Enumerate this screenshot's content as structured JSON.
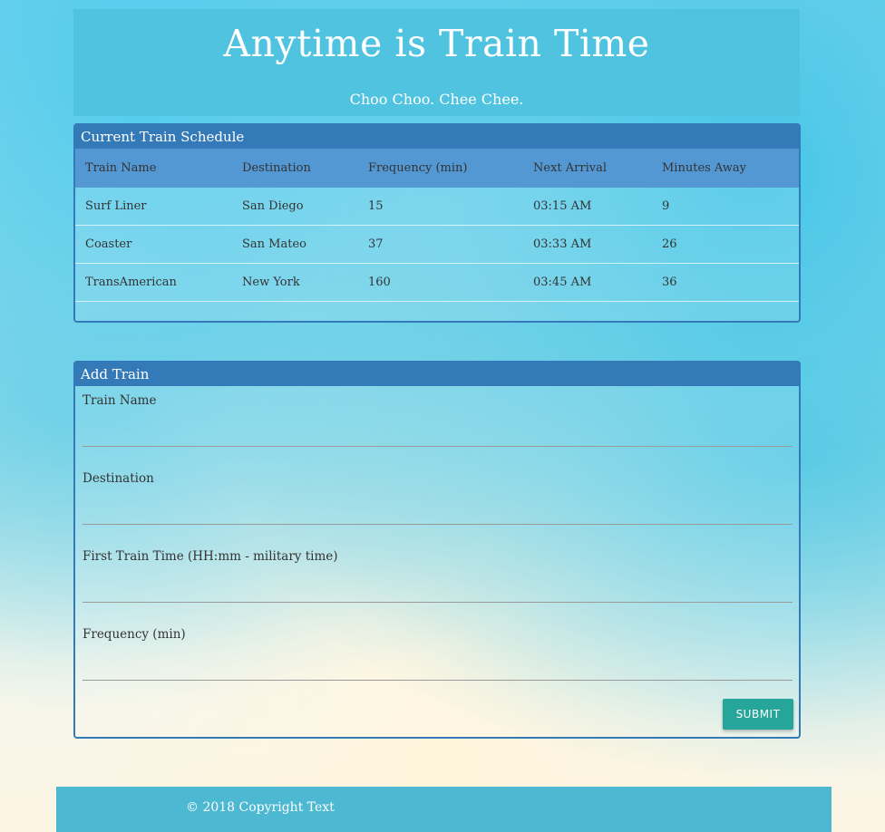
{
  "header": {
    "title": "Anytime is Train Time",
    "subtitle": "Choo Choo. Chee Chee."
  },
  "schedule": {
    "heading": "Current Train Schedule",
    "columns": [
      "Train Name",
      "Destination",
      "Frequency (min)",
      "Next Arrival",
      "Minutes Away"
    ],
    "rows": [
      [
        "Surf Liner",
        "San Diego",
        "15",
        "03:15 AM",
        "9"
      ],
      [
        "Coaster",
        "San Mateo",
        "37",
        "03:33 AM",
        "26"
      ],
      [
        "TransAmerican",
        "New York",
        "160",
        "03:45 AM",
        "36"
      ]
    ]
  },
  "add_train": {
    "heading": "Add Train",
    "fields": [
      {
        "label": "Train Name",
        "value": ""
      },
      {
        "label": "Destination",
        "value": ""
      },
      {
        "label": "First Train Time (HH:mm - military time)",
        "value": ""
      },
      {
        "label": "Frequency (min)",
        "value": ""
      }
    ],
    "submit_label": "SUBMIT"
  },
  "footer": {
    "copyright": "© 2018 Copyright Text"
  },
  "colors": {
    "header": "#4fc3df",
    "panel": "#3479b8",
    "table_head": "#5397d3",
    "submit": "#26a69a",
    "footer": "#4db8d2"
  }
}
